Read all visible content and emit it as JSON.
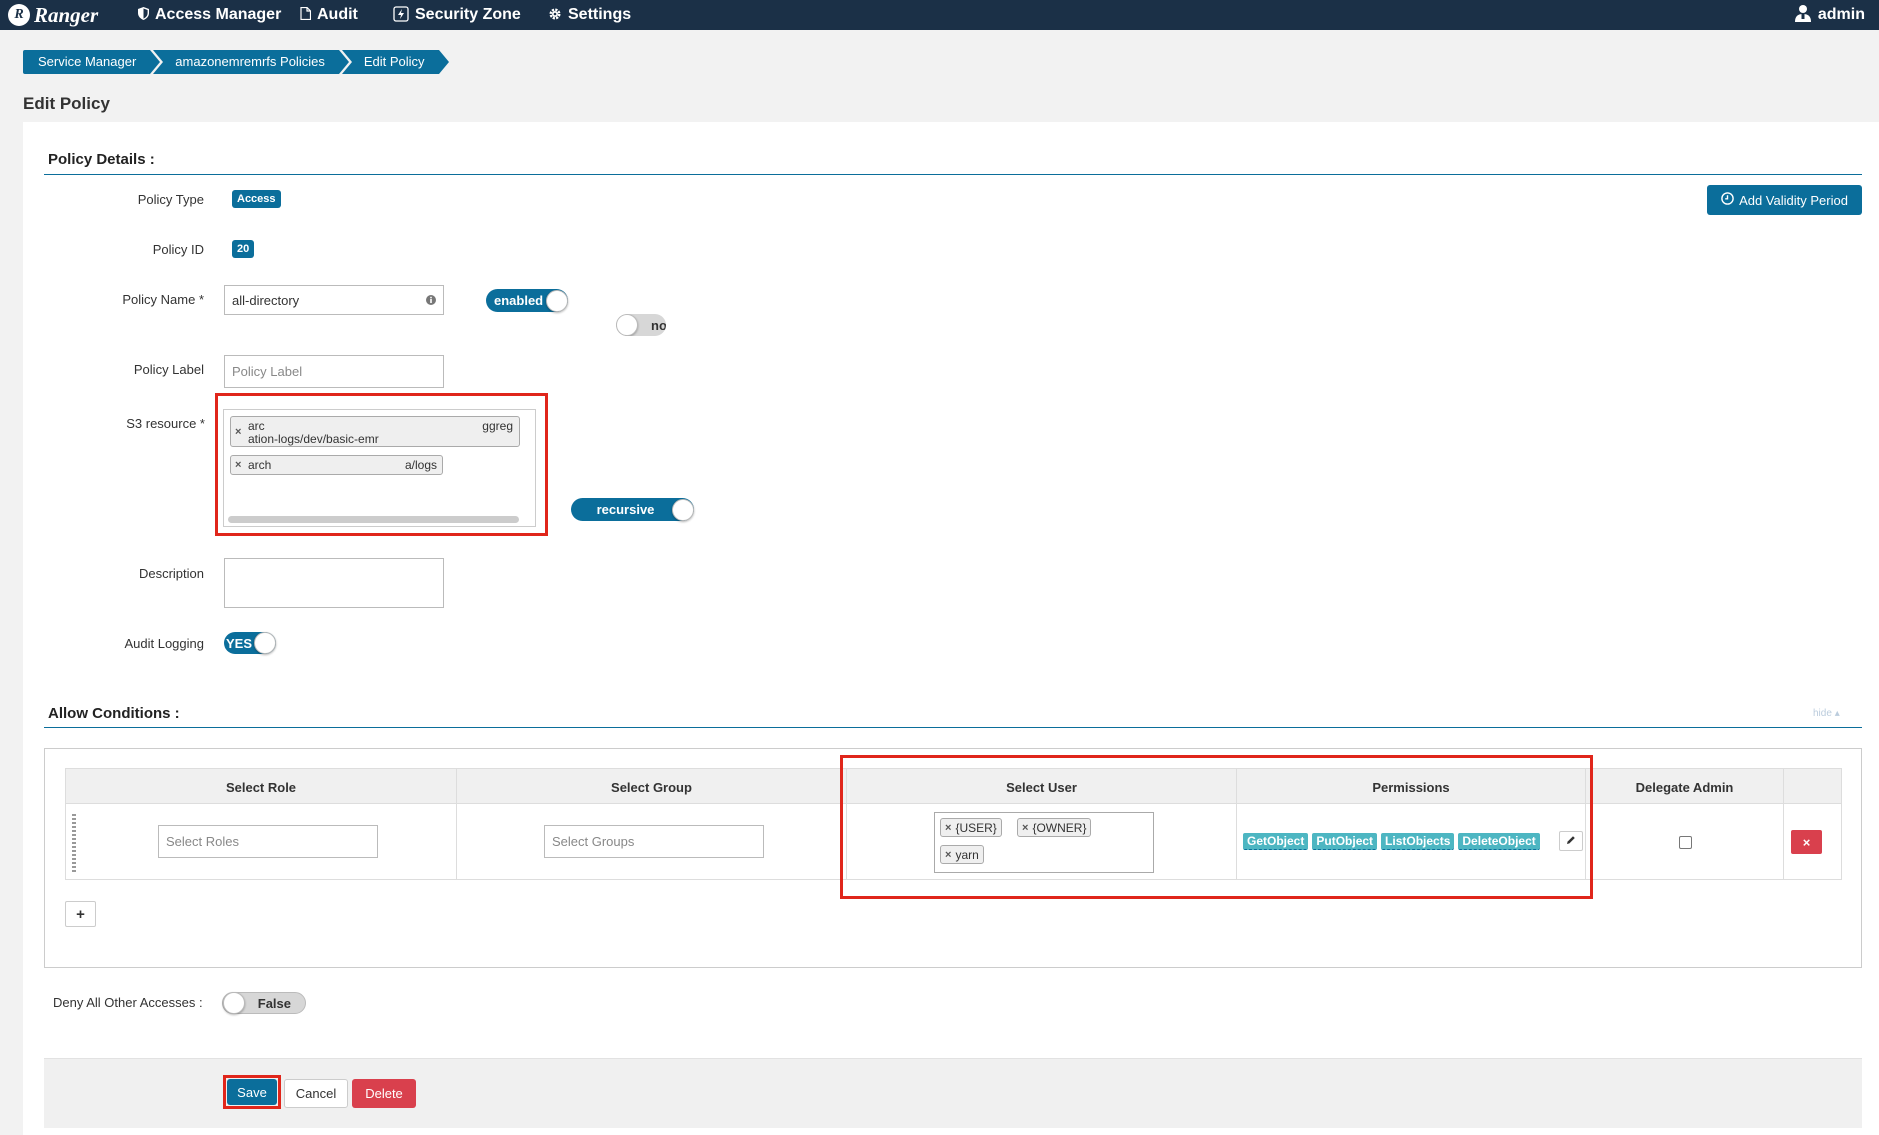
{
  "nav": {
    "brand": "Ranger",
    "brand_logo": "R",
    "items": [
      {
        "label": "Access Manager",
        "icon": "shield-icon"
      },
      {
        "label": "Audit",
        "icon": "file-icon"
      },
      {
        "label": "Security Zone",
        "icon": "bolt-icon"
      },
      {
        "label": "Settings",
        "icon": "gear-icon"
      }
    ],
    "user": "admin"
  },
  "breadcrumb": [
    "Service Manager",
    "amazonemremrfs Policies",
    "Edit Policy"
  ],
  "page_title": "Edit Policy",
  "policy_details": {
    "heading": "Policy Details :",
    "policy_type_label": "Policy Type",
    "policy_type": "Access",
    "policy_id_label": "Policy ID",
    "policy_id": "20",
    "policy_name_label": "Policy Name *",
    "policy_name": "all-directory",
    "enabled_toggle": "enabled",
    "normal_toggle": "nor",
    "policy_label_label": "Policy Label",
    "policy_label_placeholder": "Policy Label",
    "s3_resource_label": "S3 resource *",
    "s3_resources": [
      {
        "line1": "arc",
        "line1_right": "ggreg",
        "line2": "ation-logs/dev/basic-emr"
      },
      {
        "line1": "arch",
        "line1_right": "a/logs"
      }
    ],
    "recursive_toggle": "recursive",
    "description_label": "Description",
    "audit_logging_label": "Audit Logging",
    "audit_logging": "YES",
    "add_validity_button": "Add Validity Period"
  },
  "allow_conditions": {
    "heading": "Allow Conditions :",
    "hide_link": "hide",
    "columns": [
      "Select Role",
      "Select Group",
      "Select User",
      "Permissions",
      "Delegate Admin"
    ],
    "select_roles_placeholder": "Select Roles",
    "select_groups_placeholder": "Select Groups",
    "users": [
      "{USER}",
      "{OWNER}",
      "yarn"
    ],
    "permissions": [
      "GetObject",
      "PutObject",
      "ListObjects",
      "DeleteObject"
    ],
    "add_button": "+"
  },
  "deny_all": {
    "label": "Deny All Other Accesses :",
    "value": "False"
  },
  "footer": {
    "save": "Save",
    "cancel": "Cancel",
    "delete": "Delete"
  },
  "colors": {
    "nav_bg": "#1b3047",
    "accent": "#0b6e9b",
    "highlight": "#e0261b",
    "permission_tag": "#4db6c2",
    "danger": "#d9404d"
  }
}
